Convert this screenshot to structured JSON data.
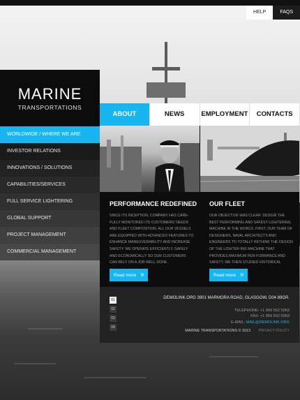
{
  "topnav": {
    "help": "HELP",
    "faqs": "FAQS"
  },
  "logo": {
    "line1": "MARINE",
    "line2": "TRANSPORTATIONS"
  },
  "sidebar": {
    "items": [
      {
        "label": "WORLDWIDE / WHERE WE ARE"
      },
      {
        "label": "INVESTOR RELATIONS"
      },
      {
        "label": "INNOVATIONS / SOLUTIONS"
      },
      {
        "label": "CAPABILITIES/SERVICES"
      },
      {
        "label": "FULL SERVICE LIGHTERING"
      },
      {
        "label": "GLOBAL SUPPORT"
      },
      {
        "label": "PROJECT MANAGEMENT"
      },
      {
        "label": "COMMERCIAL MANAGEMENT"
      }
    ]
  },
  "tabs": [
    {
      "label": "ABOUT"
    },
    {
      "label": "NEWS"
    },
    {
      "label": "EMPLOYMENT"
    },
    {
      "label": "CONTACTS"
    }
  ],
  "columns": [
    {
      "title": "PERFORMANCE REDEFINED",
      "text": "SINCE ITS INCEPTION, COMPANY HAS CARE-FULLY MONITORED ITS CUSTOMERS' NEEDS AND FLEET COMPOSITION. ALL OUR VESSELS ARE EQUIPPED WITH ADVANCED FEATURES TO ENHANCE MANEUVERABILITY AND INCREASE SAFETY. WE OPERATE EFFICIENTLY, SAFELY AND ECONOMICALLY SO OUR CUSTOMERS CAN RELY ON A JOB WELL DONE.",
      "button": "Read more"
    },
    {
      "title": "OUR FLEET",
      "text": "OUR OBJECTIVE WAS CLEAR: DESIGN THE BEST PERFORMING AND SAFEST LIGHTERING MACHINE IN THE WORLD. FIRST, OUR TEAM OF DESIGNERS, NAVAL ARCHITECTS AND ENGINEERS TO TOTALLY RETHINK THE DESIGN OF THE LIGHTER-ING MACHINE THAT PROVIDES MAXIMUM PER-FORMANCE AND SAFETY. WE THEN STUDIED HISTORICAL DESIGNS.",
      "button": "Read more"
    }
  ],
  "footer": {
    "pager": [
      "01",
      "02",
      "03",
      "04"
    ],
    "address": "DEMOLINK.ORG  3901 MARMORA ROAD, GLASGOW,  D04 89GR.",
    "telephone": "TELEPHONE: +1 959 552 5963",
    "fax": "FAX: +1 959 552 5963",
    "email_label": "E-MAIL:",
    "email": "MAIL@DEMOLINK.ORG",
    "copyright": "MARINE TRANSPORTATIONS © 2013",
    "policy": "PRIVACY POLICY"
  },
  "colors": {
    "accent": "#18b6f0",
    "dark": "#0d0d0d"
  }
}
